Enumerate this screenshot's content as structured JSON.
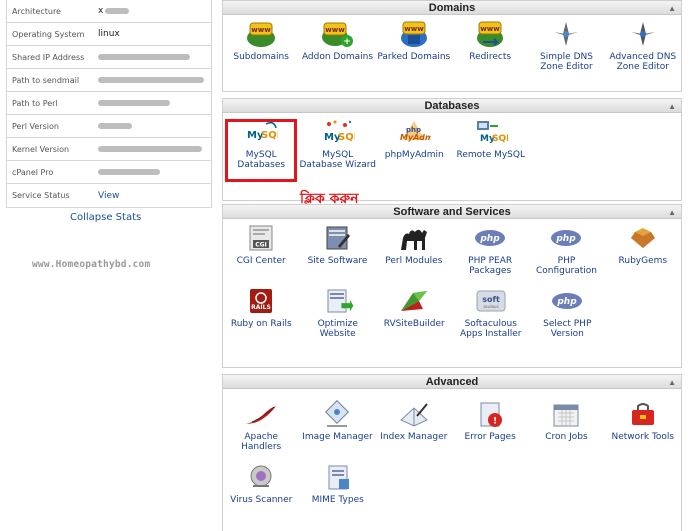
{
  "stats": {
    "rows": [
      {
        "label": "Architecture",
        "value": "x"
      },
      {
        "label": "Operating System",
        "value": "linux"
      },
      {
        "label": "Shared IP Address",
        "value": ""
      },
      {
        "label": "Path to sendmail",
        "value": ""
      },
      {
        "label": "Path to Perl",
        "value": ""
      },
      {
        "label": "Perl Version",
        "value": ""
      },
      {
        "label": "Kernel Version",
        "value": ""
      },
      {
        "label": "cPanel Pro",
        "value": ""
      },
      {
        "label": "Service Status",
        "value": "View"
      }
    ],
    "collapse_label": "Collapse Stats"
  },
  "watermark": "www.Homeopathybd.com",
  "annotation": {
    "text": "ক্লিক করুন",
    "color": "#e1151b"
  },
  "sections": {
    "domains": {
      "title": "Domains",
      "items": [
        {
          "label": "Subdomains",
          "icon": "www-icon"
        },
        {
          "label": "Addon Domains",
          "icon": "www-add-icon"
        },
        {
          "label": "Parked Domains",
          "icon": "www-parked-icon"
        },
        {
          "label": "Redirects",
          "icon": "www-redirect-icon"
        },
        {
          "label": "Simple DNS Zone Editor",
          "icon": "dns-icon"
        },
        {
          "label": "Advanced DNS Zone Editor",
          "icon": "dns-advanced-icon"
        }
      ]
    },
    "databases": {
      "title": "Databases",
      "items": [
        {
          "label": "MySQL Databases",
          "icon": "mysql-icon"
        },
        {
          "label": "MySQL Database Wizard",
          "icon": "mysql-wizard-icon"
        },
        {
          "label": "phpMyAdmin",
          "icon": "phpmyadmin-icon"
        },
        {
          "label": "Remote MySQL",
          "icon": "remote-mysql-icon"
        }
      ]
    },
    "software": {
      "title": "Software and Services",
      "items": [
        {
          "label": "CGI Center",
          "icon": "cgi-icon"
        },
        {
          "label": "Site Software",
          "icon": "site-software-icon"
        },
        {
          "label": "Perl Modules",
          "icon": "camel-icon"
        },
        {
          "label": "PHP PEAR Packages",
          "icon": "php-icon"
        },
        {
          "label": "PHP Configuration",
          "icon": "php-config-icon"
        },
        {
          "label": "RubyGems",
          "icon": "ruby-gem-icon"
        },
        {
          "label": "Ruby on Rails",
          "icon": "rails-icon"
        },
        {
          "label": "Optimize Website",
          "icon": "optimize-icon"
        },
        {
          "label": "RVSiteBuilder",
          "icon": "rvsitebuilder-icon"
        },
        {
          "label": "Softaculous Apps Installer",
          "icon": "softaculous-icon"
        },
        {
          "label": "Select PHP Version",
          "icon": "select-php-icon"
        }
      ]
    },
    "advanced": {
      "title": "Advanced",
      "items": [
        {
          "label": "Apache Handlers",
          "icon": "feather-icon"
        },
        {
          "label": "Image Manager",
          "icon": "image-manager-icon"
        },
        {
          "label": "Index Manager",
          "icon": "index-manager-icon"
        },
        {
          "label": "Error Pages",
          "icon": "error-pages-icon"
        },
        {
          "label": "Cron Jobs",
          "icon": "calendar-icon"
        },
        {
          "label": "Network Tools",
          "icon": "network-tools-icon"
        },
        {
          "label": "Virus Scanner",
          "icon": "virus-scanner-icon"
        },
        {
          "label": "MIME Types",
          "icon": "mime-icon"
        }
      ]
    }
  },
  "colors": {
    "link": "#1a3e8c",
    "highlight": "#e1151b"
  }
}
